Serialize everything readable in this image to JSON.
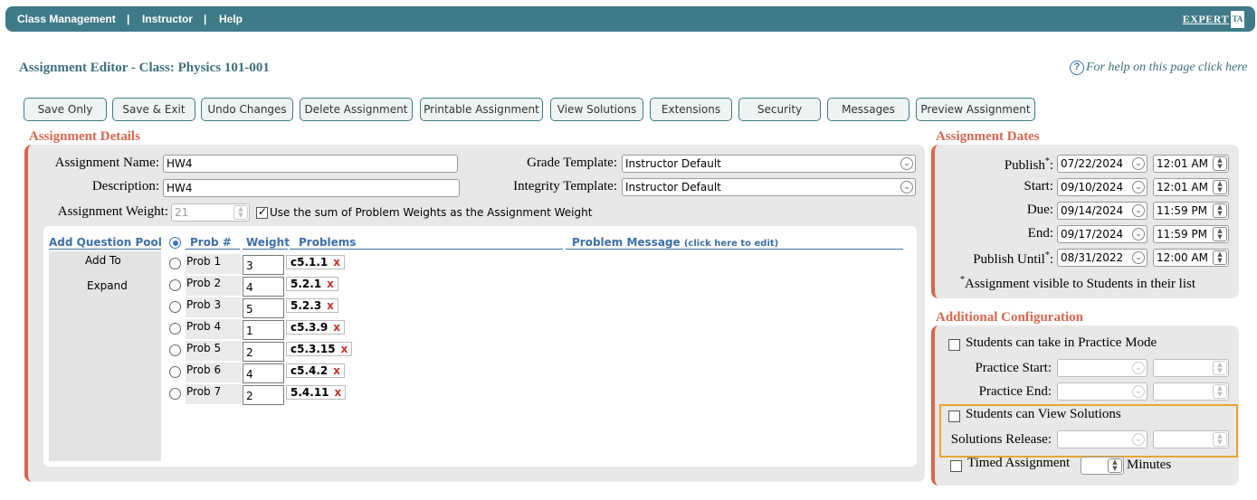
{
  "nav": {
    "items": [
      "Class Management",
      "Instructor",
      "Help"
    ],
    "separator": "|",
    "logo_text": "EXPERT",
    "logo_badge": "TA"
  },
  "page": {
    "title": "Assignment Editor - Class: Physics 101-001",
    "help_text": "For help on this page click here"
  },
  "toolbar": {
    "buttons": [
      "Save Only",
      "Save & Exit",
      "Undo Changes",
      "Delete Assignment",
      "Printable Assignment",
      "View Solutions",
      "Extensions",
      "Security",
      "Messages",
      "Preview Assignment"
    ]
  },
  "details": {
    "section_title": "Assignment Details",
    "name_label": "Assignment Name:",
    "name_value": "HW4",
    "description_label": "Description:",
    "description_value": "HW4",
    "weight_label": "Assignment Weight:",
    "weight_value": "21",
    "sum_weights_label": "Use the sum of Problem Weights as the Assignment Weight",
    "sum_weights_checked": true,
    "grade_template_label": "Grade Template:",
    "grade_template_value": "Instructor Default",
    "integrity_template_label": "Integrity Template:",
    "integrity_template_value": "Instructor Default"
  },
  "problems": {
    "add_pool_label": "Add Question Pool",
    "add_to_label": "Add To",
    "expand_label": "Expand",
    "col_prob": "Prob #",
    "col_weight": "Weight",
    "col_problems": "Problems",
    "col_message": "Problem Message",
    "col_message_hint": "(click here to edit)",
    "remove_symbol": "x",
    "rows": [
      {
        "label": "Prob 1",
        "weight": "3",
        "problem": "c5.1.1"
      },
      {
        "label": "Prob 2",
        "weight": "4",
        "problem": "5.2.1"
      },
      {
        "label": "Prob 3",
        "weight": "5",
        "problem": "5.2.3"
      },
      {
        "label": "Prob 4",
        "weight": "1",
        "problem": "c5.3.9"
      },
      {
        "label": "Prob 5",
        "weight": "2",
        "problem": "c5.3.15"
      },
      {
        "label": "Prob 6",
        "weight": "4",
        "problem": "c5.4.2"
      },
      {
        "label": "Prob 7",
        "weight": "2",
        "problem": "5.4.11"
      }
    ]
  },
  "dates": {
    "section_title": "Assignment Dates",
    "rows": [
      {
        "label": "Publish",
        "star": "*",
        "colon": ":",
        "date": "07/22/2024",
        "time": "12:01 AM"
      },
      {
        "label": "Start",
        "star": "",
        "colon": ":",
        "date": "09/10/2024",
        "time": "12:01 AM"
      },
      {
        "label": "Due",
        "star": "",
        "colon": ":",
        "date": "09/14/2024",
        "time": "11:59 PM"
      },
      {
        "label": "End",
        "star": "",
        "colon": ":",
        "date": "09/17/2024",
        "time": "11:59 PM"
      },
      {
        "label": "Publish Until",
        "star": "*",
        "colon": ":",
        "date": "08/31/2022",
        "time": "12:00 AM"
      }
    ],
    "footnote_star": "*",
    "footnote": "Assignment visible to Students in their list"
  },
  "config": {
    "section_title": "Additional Configuration",
    "practice_mode_label": "Students can take in Practice Mode",
    "practice_start_label": "Practice Start:",
    "practice_end_label": "Practice End:",
    "view_solutions_label": "Students can View Solutions",
    "solutions_release_label": "Solutions Release:",
    "timed_label": "Timed Assignment",
    "minutes_label": "Minutes"
  },
  "colors": {
    "nav_bg": "#3e7a87",
    "section_title": "#d9664e",
    "highlight": "#e8a62e",
    "link_blue": "#3c6fa8",
    "remove_red": "#c8302a"
  }
}
